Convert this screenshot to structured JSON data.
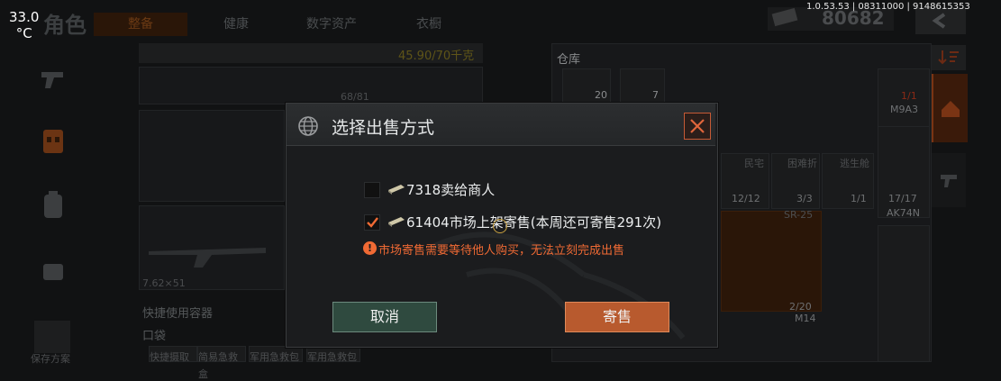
{
  "status": {
    "temperature": "33.0",
    "temperature_unit": "°C",
    "version": "1.0.53.53 | 08311000 | 9148615353"
  },
  "header": {
    "title": "角色",
    "tabs": [
      {
        "label": "整备",
        "active": true
      },
      {
        "label": "健康",
        "active": false
      },
      {
        "label": "数字资产",
        "active": false
      },
      {
        "label": "衣橱",
        "active": false
      }
    ],
    "currency_value": "80682"
  },
  "loadout": {
    "weight": "45.90/70千克",
    "slot_capacity": "68/81",
    "ammo_label": "7.62×51",
    "quick_use_label": "快捷使用容器",
    "pocket_label": "口袋",
    "quick_items": [
      "快捷摄取",
      "简易急救盒",
      "军用急救包",
      "军用急救包"
    ],
    "save_label": "保存方案"
  },
  "warehouse": {
    "label": "仓库",
    "top_counts": [
      "20",
      "7"
    ],
    "tool_names": [
      "民宅",
      "困难折",
      "逃生舱"
    ],
    "tool_counts": [
      "12/12",
      "3/3",
      "1/1"
    ],
    "weapons": [
      {
        "name": "M9A3",
        "count": "1/1"
      },
      {
        "name": "AK74N",
        "count": "17/17"
      },
      {
        "name": "SR-25",
        "count": ""
      },
      {
        "name": "M14",
        "count": "2/20"
      }
    ]
  },
  "dialog": {
    "title": "选择出售方式",
    "options": [
      {
        "label": "7318卖给商人",
        "checked": false
      },
      {
        "label": "61404市场上架寄售(本周还可寄售291次)",
        "checked": true
      }
    ],
    "warning": "市场寄售需要等待他人购买，无法立刻完成出售",
    "cancel_label": "取消",
    "sell_label": "寄售"
  },
  "colors": {
    "accent_orange": "#f06a34",
    "sell_button": "#b85a2e",
    "cancel_button": "#2f4a3f"
  }
}
